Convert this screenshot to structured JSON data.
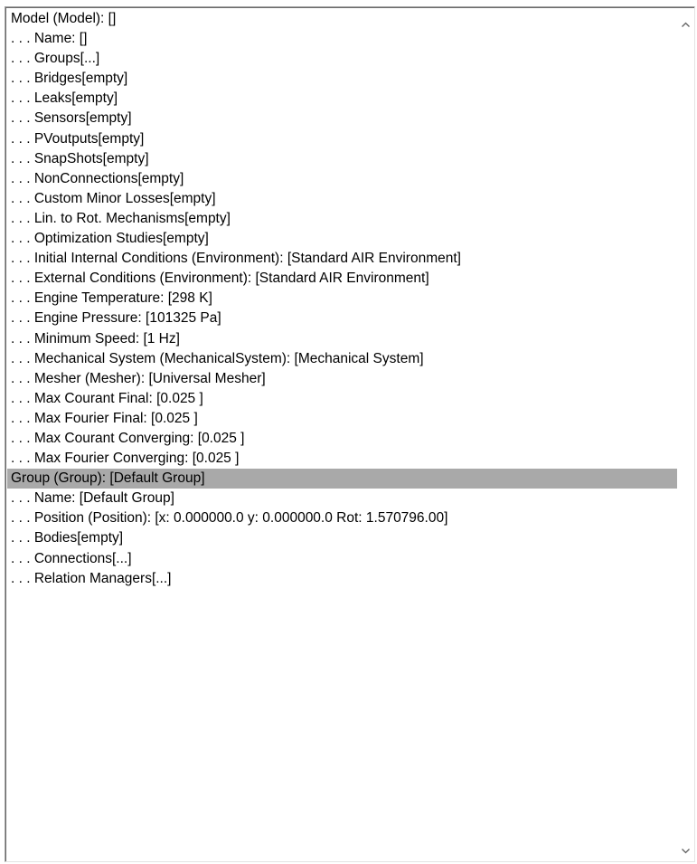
{
  "tree": {
    "rows": [
      {
        "text": "Model (Model): []",
        "selected": false
      },
      {
        "text": ". . . Name: []",
        "selected": false
      },
      {
        "text": ". . . Groups[...]",
        "selected": false
      },
      {
        "text": ". . . Bridges[empty]",
        "selected": false
      },
      {
        "text": ". . . Leaks[empty]",
        "selected": false
      },
      {
        "text": ". . . Sensors[empty]",
        "selected": false
      },
      {
        "text": ". . . PVoutputs[empty]",
        "selected": false
      },
      {
        "text": ". . . SnapShots[empty]",
        "selected": false
      },
      {
        "text": ". . . NonConnections[empty]",
        "selected": false
      },
      {
        "text": ". . . Custom Minor Losses[empty]",
        "selected": false
      },
      {
        "text": ". . . Lin. to Rot. Mechanisms[empty]",
        "selected": false
      },
      {
        "text": ". . . Optimization Studies[empty]",
        "selected": false
      },
      {
        "text": ". . . Initial Internal Conditions (Environment): [Standard AIR Environment]",
        "selected": false
      },
      {
        "text": ". . . External Conditions (Environment): [Standard AIR Environment]",
        "selected": false
      },
      {
        "text": ". . . Engine Temperature: [298 K]",
        "selected": false
      },
      {
        "text": ". . . Engine Pressure: [101325 Pa]",
        "selected": false
      },
      {
        "text": ". . . Minimum Speed: [1 Hz]",
        "selected": false
      },
      {
        "text": ". . . Mechanical System (MechanicalSystem): [Mechanical System]",
        "selected": false
      },
      {
        "text": ". . . Mesher (Mesher): [Universal Mesher]",
        "selected": false
      },
      {
        "text": ". . . Max Courant Final: [0.025 ]",
        "selected": false
      },
      {
        "text": ". . . Max Fourier Final: [0.025 ]",
        "selected": false
      },
      {
        "text": ". . . Max Courant Converging: [0.025 ]",
        "selected": false
      },
      {
        "text": ". . . Max Fourier Converging: [0.025 ]",
        "selected": false
      },
      {
        "text": "Group (Group): [Default Group]",
        "selected": true
      },
      {
        "text": ". . . Name: [Default Group]",
        "selected": false
      },
      {
        "text": ". . . Position (Position): [x: 0.000000.0 y: 0.000000.0 Rot: 1.570796.00]",
        "selected": false
      },
      {
        "text": ". . . Bodies[empty]",
        "selected": false
      },
      {
        "text": ". . . Connections[...]",
        "selected": false
      },
      {
        "text": ". . . Relation Managers[...]",
        "selected": false
      }
    ]
  },
  "scrollbar": {
    "up_icon": "chevron-up-icon",
    "down_icon": "chevron-down-icon",
    "arrow_color": "#606060"
  },
  "colors": {
    "selection": "#a9a9a9",
    "text": "#000000"
  }
}
